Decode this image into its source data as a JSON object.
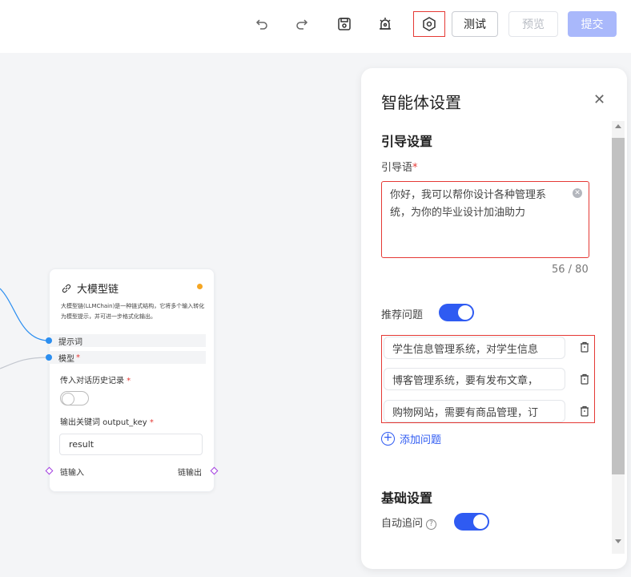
{
  "toolbar": {
    "test_label": "测试",
    "preview_label": "预览",
    "submit_label": "提交",
    "icons": [
      "undo-icon",
      "redo-icon",
      "save-icon",
      "debug-icon",
      "agent-settings-icon"
    ]
  },
  "node": {
    "title": "大模型链",
    "description": "大模型链(LLMChain)是一种链式结构，它将多个输入转化为模型提示，并可进一步格式化输出。",
    "rows": [
      "提示词",
      "模型"
    ],
    "history_label": "传入对话历史记录",
    "output_key_label": "输出关键词 output_key",
    "output_key_value": "result",
    "chain_in": "链输入",
    "chain_out": "链输出"
  },
  "panel": {
    "title": "智能体设置",
    "guide_section": "引导设置",
    "guide_label": "引导语",
    "guide_text": "你好，我可以帮你设计各种管理系统，为你的毕业设计加油助力",
    "counter": "56 / 80",
    "recommend_label": "推荐问题",
    "questions": [
      "学生信息管理系统，对学生信息",
      "博客管理系统，要有发布文章，",
      "购物网站，需要有商品管理，订"
    ],
    "add_question": "添加问题",
    "basic_section": "基础设置",
    "auto_followup": "自动追问"
  },
  "colors": {
    "accent": "#2f5bf2",
    "submit_disabled": "#a9b8fb",
    "highlight_border": "#e53935",
    "edge": "#2b8ef0",
    "status_dot": "#f5a623",
    "port": "#a23ee0"
  }
}
